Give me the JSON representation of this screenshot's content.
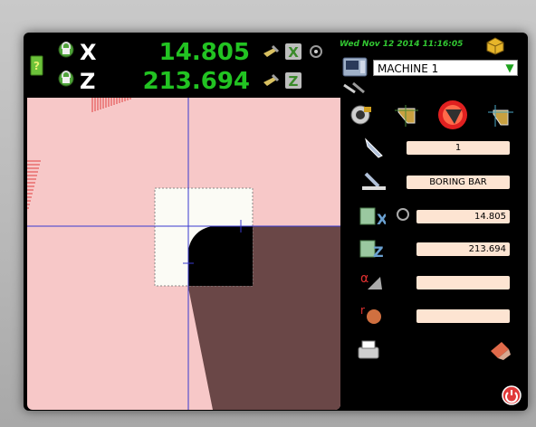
{
  "axes": [
    {
      "letter": "X",
      "value": "14.805"
    },
    {
      "letter": "Z",
      "value": "213.694"
    }
  ],
  "header": {
    "datetime": "Wed Nov 12 2014 11:16:05",
    "machine_selected": "MACHINE 1"
  },
  "tool": {
    "number": "1",
    "name": "BORING BAR",
    "x_offset": "14.805",
    "z_offset": "213.694",
    "angle": "",
    "radius": ""
  },
  "colors": {
    "axis_value": "#22c322",
    "canvas_bg": "#f7c8c8",
    "field_bg": "#fde4d2",
    "crosshair": "#3a3ad0",
    "shadow_region": "#6a4747"
  },
  "icons": [
    "lock-icon",
    "help-book-icon",
    "tool-set-icon",
    "zero-axis-icon",
    "measure-icon",
    "package-icon",
    "machine-icon",
    "camera-icon",
    "view-mode-icons",
    "tool-icon",
    "touch-off-icon",
    "angle-icon",
    "radius-icon",
    "printer-icon",
    "eraser-icon",
    "power-icon"
  ]
}
